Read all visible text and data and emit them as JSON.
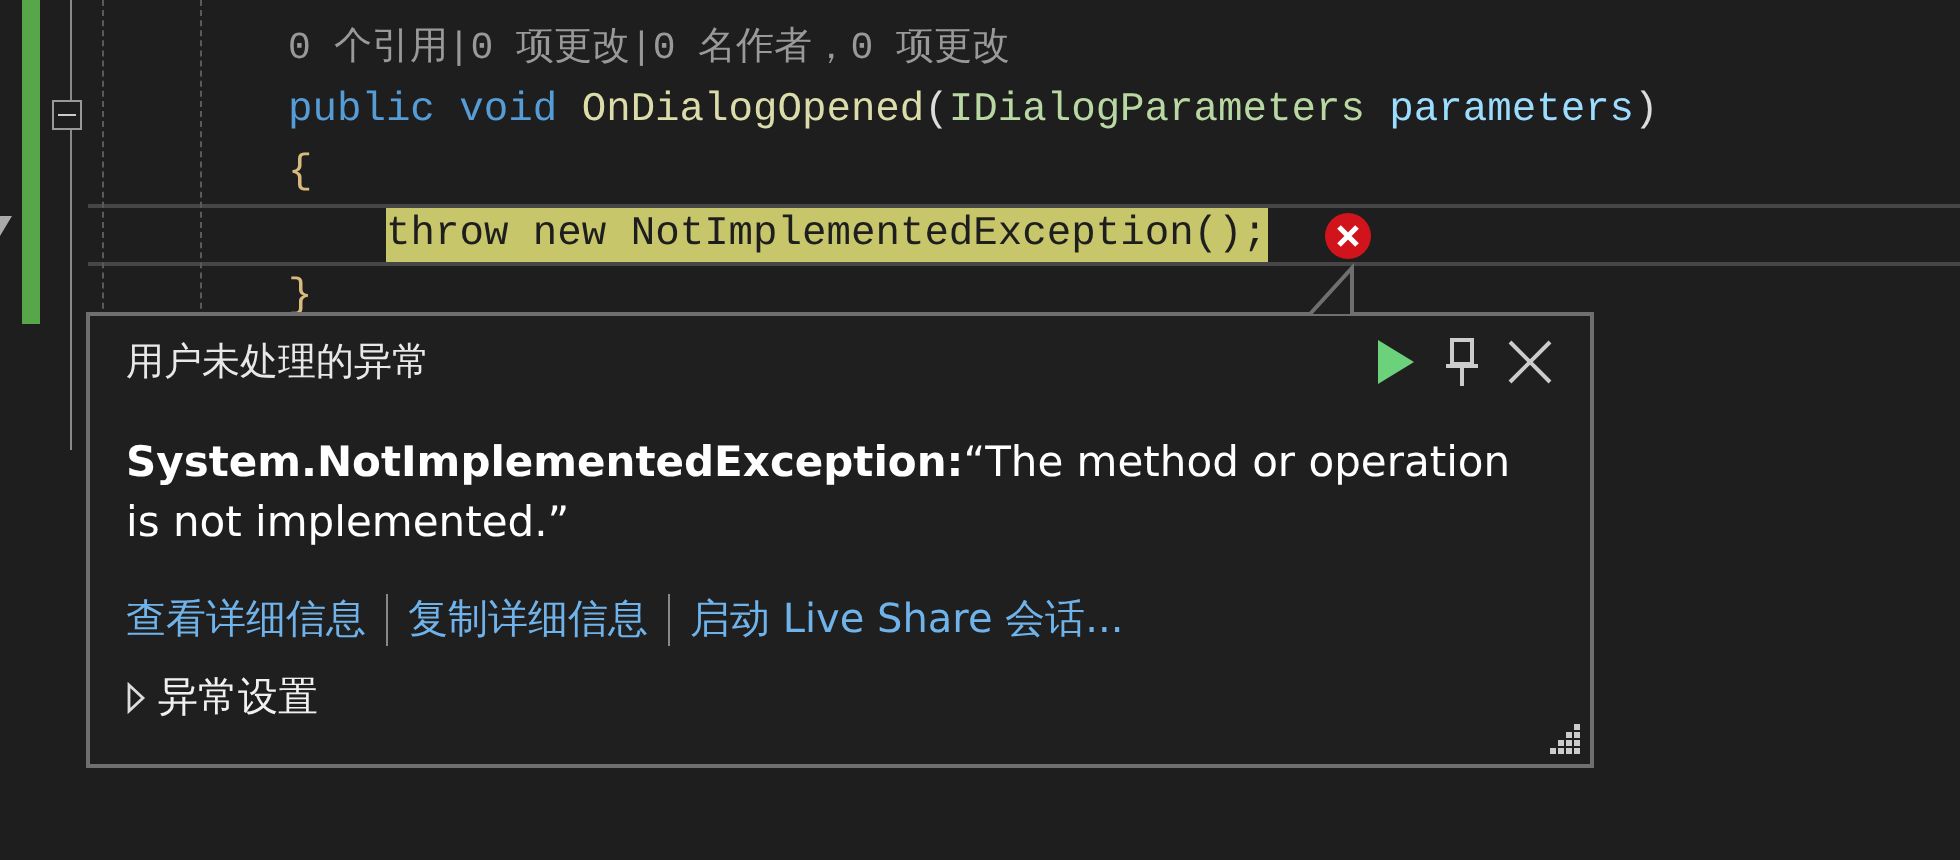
{
  "editor": {
    "codelens": "0 个引用|0 项更改|0 名作者，0 项更改",
    "lines": [
      {
        "tokens": [
          {
            "kind": "keyword",
            "text": "public "
          },
          {
            "kind": "keyword",
            "text": "void "
          },
          {
            "kind": "method",
            "text": "OnDialogOpened"
          },
          {
            "kind": "plain",
            "text": "("
          },
          {
            "kind": "type",
            "text": "IDialogParameters "
          },
          {
            "kind": "param",
            "text": "parameters"
          },
          {
            "kind": "plain",
            "text": ")"
          }
        ]
      },
      {
        "tokens": [
          {
            "kind": "brace",
            "text": "{"
          }
        ],
        "children": [
          {
            "current": true,
            "tokens": [
              {
                "kind": "statement",
                "text": "throw new NotImplementedException();"
              }
            ]
          }
        ]
      },
      {
        "tokens": [
          {
            "kind": "brace",
            "text": "}"
          }
        ]
      }
    ]
  },
  "popup": {
    "title": "用户未处理的异常",
    "message": "**System.NotImplementedException:**“The method or operation is not implemented.”",
    "links": [
      "查看详细信息",
      "复制详细信息",
      "启动 Live Share 会话..."
    ],
    "settings": {
      "label": "异常设置",
      "expanded": false
    }
  }
}
